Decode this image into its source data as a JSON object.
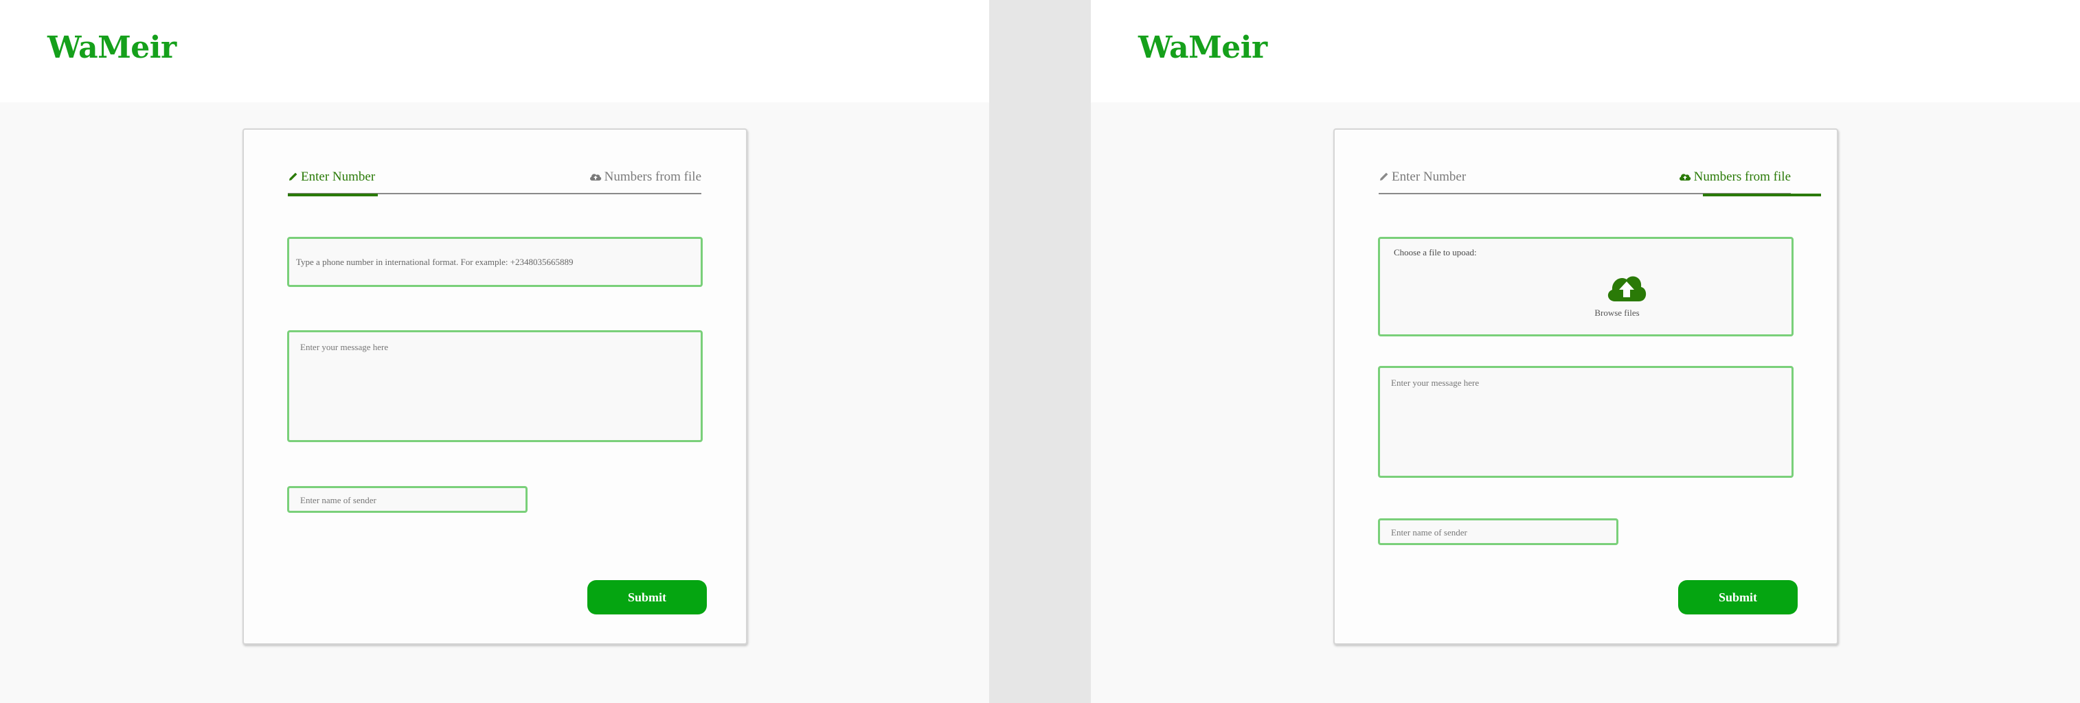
{
  "app": {
    "logo": "WaMeir"
  },
  "colors": {
    "brand_green": "#15a01b",
    "accent_dark_green": "#2a7a07",
    "field_border": "#7ad07a",
    "submit_bg": "#05a511"
  },
  "left_screen": {
    "tabs": [
      {
        "label": "Enter Number",
        "icon": "pencil-icon",
        "active": true
      },
      {
        "label": "Numbers from file",
        "icon": "cloud-upload-icon",
        "active": false
      }
    ],
    "phone_field": {
      "placeholder": "Type a phone number in international format. For example: +2348035665889"
    },
    "message_field": {
      "placeholder": "Enter your message here"
    },
    "sender_field": {
      "placeholder": "Enter name of sender"
    },
    "submit_label": "Submit"
  },
  "right_screen": {
    "tabs": [
      {
        "label": "Enter Number",
        "icon": "pencil-icon",
        "active": false
      },
      {
        "label": "Numbers from file",
        "icon": "cloud-upload-icon",
        "active": true
      }
    ],
    "upload": {
      "label": "Choose a file to upoad:",
      "browse_label": "Browse files",
      "icon": "cloud-upload-icon"
    },
    "message_field": {
      "placeholder": "Enter your message here"
    },
    "sender_field": {
      "placeholder": "Enter name of sender"
    },
    "submit_label": "Submit"
  }
}
